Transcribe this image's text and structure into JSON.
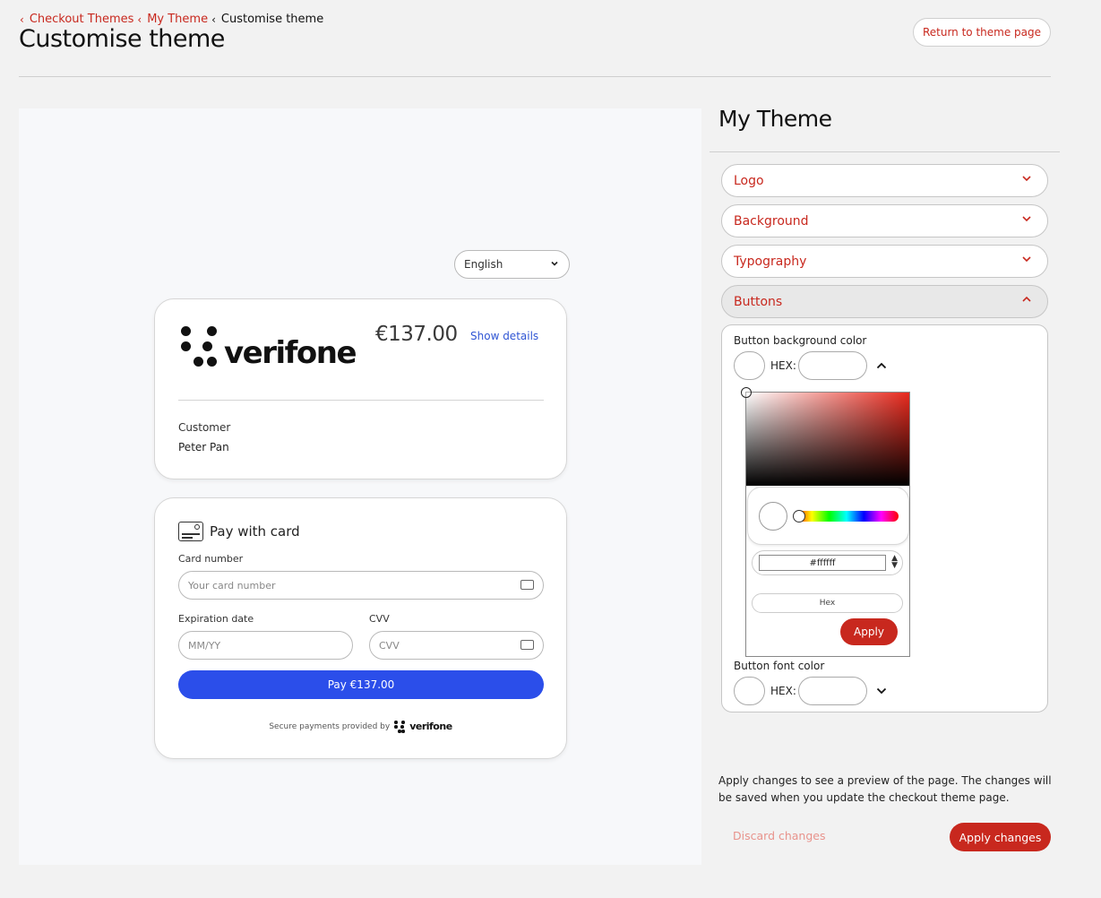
{
  "breadcrumb": [
    {
      "label": "Checkout Themes",
      "link": true
    },
    {
      "label": "My Theme",
      "link": true
    },
    {
      "label": "Customise theme",
      "link": false
    }
  ],
  "page_title": "Customise theme",
  "return_button": "Return to theme page",
  "preview": {
    "language": "English",
    "logo_word": "verifone",
    "amount": "€137.00",
    "show_details": "Show details",
    "customer_label": "Customer",
    "customer_name": "Peter Pan",
    "pay_with_card": "Pay with card",
    "card_number_label": "Card number",
    "card_number_placeholder": "Your card number",
    "expiration_label": "Expiration date",
    "expiration_placeholder": "MM/YY",
    "cvv_label": "CVV",
    "cvv_placeholder": "CVV",
    "pay_button": "Pay €137.00",
    "secure_text": "Secure payments provided by",
    "secure_logo_word": "verifone"
  },
  "panel": {
    "title": "My Theme",
    "sections": [
      "Logo",
      "Background",
      "Typography",
      "Buttons"
    ],
    "open_section": "Buttons",
    "button_bg_label": "Button background color",
    "hex_label": "HEX:",
    "picker": {
      "hex_value": "#ffffff",
      "mode": "Hex",
      "apply": "Apply",
      "hue_color": "#e8291d"
    },
    "button_font_label": "Button font color",
    "hex_label_2": "HEX:"
  },
  "footer": {
    "hint": "Apply changes to see a preview of the page. The changes will be saved when you update the checkout theme page.",
    "discard": "Discard changes",
    "apply": "Apply changes"
  },
  "colors": {
    "accent": "#c8281e",
    "pay_button": "#2b4eea",
    "link_blue": "#2f55d4"
  }
}
